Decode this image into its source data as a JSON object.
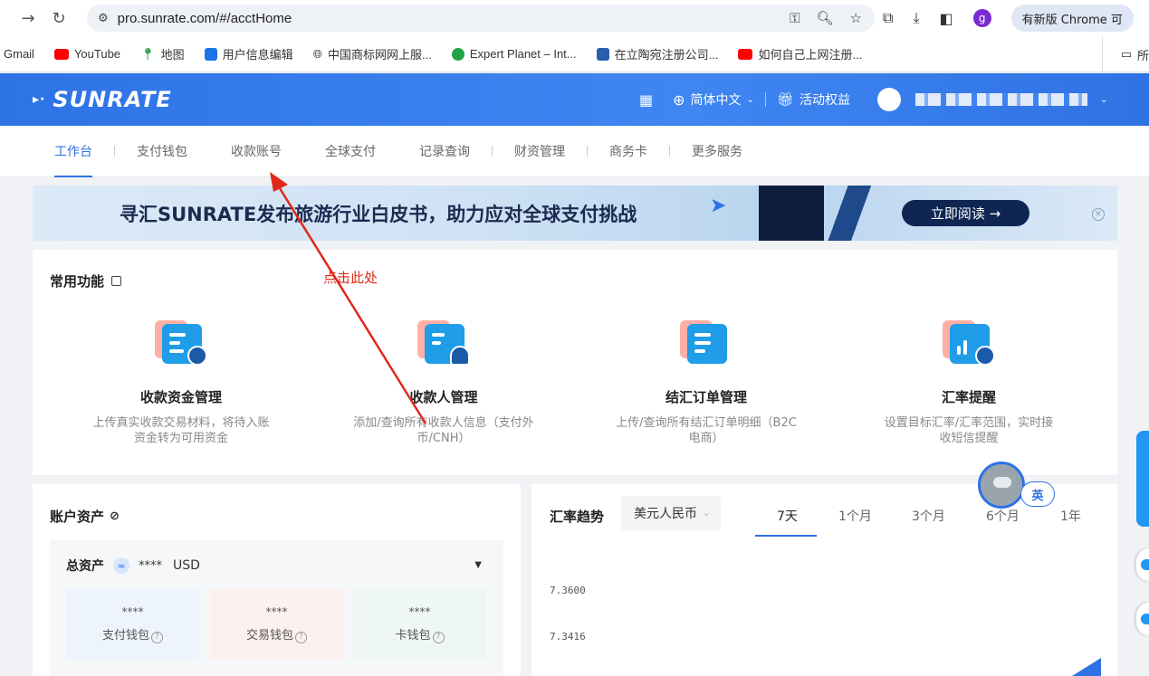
{
  "browser": {
    "url": "pro.sunrate.com/#/acctHome",
    "update_label": "有新版 Chrome 可",
    "profile_initial": "g"
  },
  "bookmarks": [
    {
      "label": "Gmail",
      "color": ""
    },
    {
      "label": "YouTube",
      "color": "#ff0000"
    },
    {
      "label": "地图",
      "color": "#34a853"
    },
    {
      "label": "用户信息编辑",
      "color": "#1a73e8"
    },
    {
      "label": "中国商标网网上服...",
      "color": "#333333"
    },
    {
      "label": "Expert Planet – Int...",
      "color": "#1ea446"
    },
    {
      "label": "在立陶宛注册公司...",
      "color": "#2a5db0"
    },
    {
      "label": "如何自己上网注册...",
      "color": "#ff0000"
    }
  ],
  "bookmarks_more": "所",
  "header": {
    "logo": "SUNRATE",
    "language": "简体中文",
    "benefits": "活动权益"
  },
  "tabs": [
    "工作台",
    "支付钱包",
    "收款账号",
    "全球支付",
    "记录查询",
    "财资管理",
    "商务卡",
    "更多服务"
  ],
  "banner": {
    "title": "寻汇SUNRATE发布旅游行业白皮书，助力应对全球支付挑战",
    "button": "立即阅读 →"
  },
  "annotation": "点击此处",
  "functions": {
    "title": "常用功能",
    "items": [
      {
        "name": "收款资金管理",
        "desc": "上传真实收款交易材料，将待入账资金转为可用资金"
      },
      {
        "name": "收款人管理",
        "desc": "添加/查询所有收款人信息（支付外币/CNH）"
      },
      {
        "name": "结汇订单管理",
        "desc": "上传/查询所有结汇订单明细（B2C电商）"
      },
      {
        "name": "汇率提醒",
        "desc": "设置目标汇率/汇率范围，实时接收短信提醒"
      }
    ]
  },
  "assets": {
    "title": "账户资产",
    "total_label": "总资产",
    "total_value": "****",
    "currency": "USD",
    "wallets": [
      {
        "name": "支付钱包",
        "value": "****",
        "color": "#eef4fc"
      },
      {
        "name": "交易钱包",
        "value": "****",
        "color": "#fdf1f0"
      },
      {
        "name": "卡钱包",
        "value": "****",
        "color": "#eef7f1"
      }
    ]
  },
  "rates": {
    "title": "汇率趋势",
    "pair": "美元人民币",
    "periods": [
      "7天",
      "1个月",
      "3个月",
      "6个月",
      "1年"
    ],
    "active_period": "7天",
    "y_values": [
      "7.3600",
      "7.3416"
    ]
  },
  "lang_toggle": "英"
}
